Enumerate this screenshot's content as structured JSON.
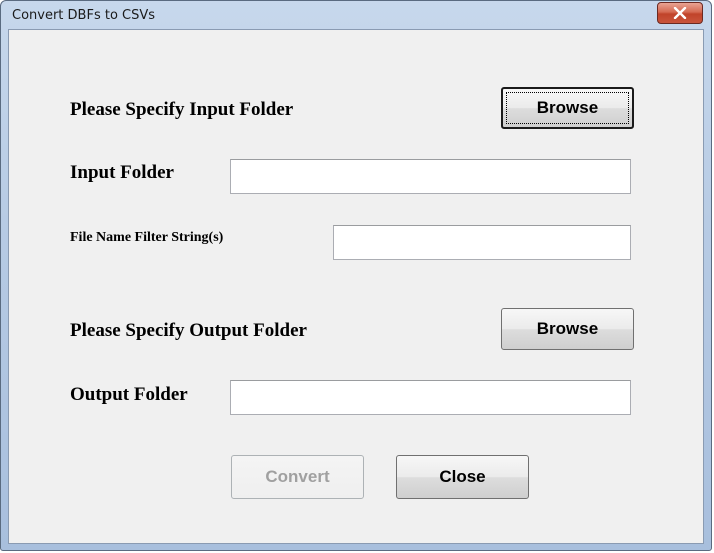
{
  "window": {
    "title": "Convert DBFs to CSVs"
  },
  "form": {
    "input_section_label": "Please Specify Input Folder",
    "input_browse_label": "Browse",
    "input_folder_label": "Input Folder",
    "input_folder_value": "",
    "filter_label": "File Name Filter String(s)",
    "filter_value": "",
    "output_section_label": "Please Specify Output Folder",
    "output_browse_label": "Browse",
    "output_folder_label": "Output Folder",
    "output_folder_value": "",
    "convert_label": "Convert",
    "close_label": "Close"
  },
  "icons": {
    "title_close": "close-icon"
  },
  "colors": {
    "close_button": "#c9553c",
    "dialog_background": "#f0f0f0",
    "disabled_text": "#a0a0a0"
  }
}
